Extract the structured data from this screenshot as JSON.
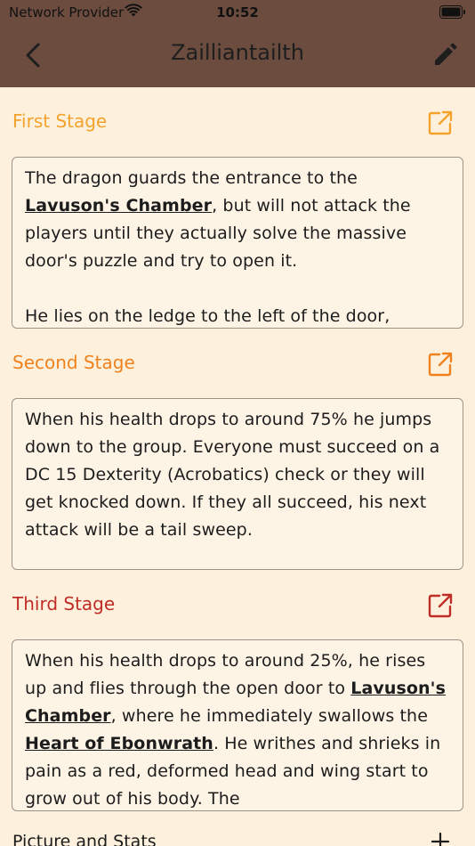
{
  "status": {
    "carrier": "Network Provider",
    "time": "10:52"
  },
  "nav": {
    "title": "Zailliantailth"
  },
  "colors": {
    "stage1": "#f5a22d",
    "stage2": "#f0821e",
    "stage3": "#c02c26",
    "header": "#6b4c3f"
  },
  "stages": [
    {
      "title": "First Stage",
      "text": [
        [
          "The dragon guards the entrance to the "
        ],
        [
          "Lavuson's Chamber",
          "link"
        ],
        [
          ", but will not attack the players until they actually solve the massive door's puzzle and try to open it."
        ]
      ],
      "text2": "He lies on the ledge to the left of the door,"
    },
    {
      "title": "Second Stage",
      "text": "When his health drops to around 75% he jumps down to the group. Everyone must succeed on a DC 15 Dexterity (Acrobatics) check or they will get knocked down. If they all succeed, his next attack will be a tail sweep."
    },
    {
      "title": "Third Stage",
      "text_a": "When his health drops to around 25%, he rises up and flies through the open door to ",
      "link_a": "Lavuson's Chamber",
      "text_b": ", where he immediately swallows the ",
      "link_b": "Heart of Ebonwrath",
      "text_c": ". He writhes and shrieks in pain as a red, deformed head and wing start to grow out of his body. The"
    }
  ],
  "bottom": {
    "label": "Picture and Stats"
  }
}
